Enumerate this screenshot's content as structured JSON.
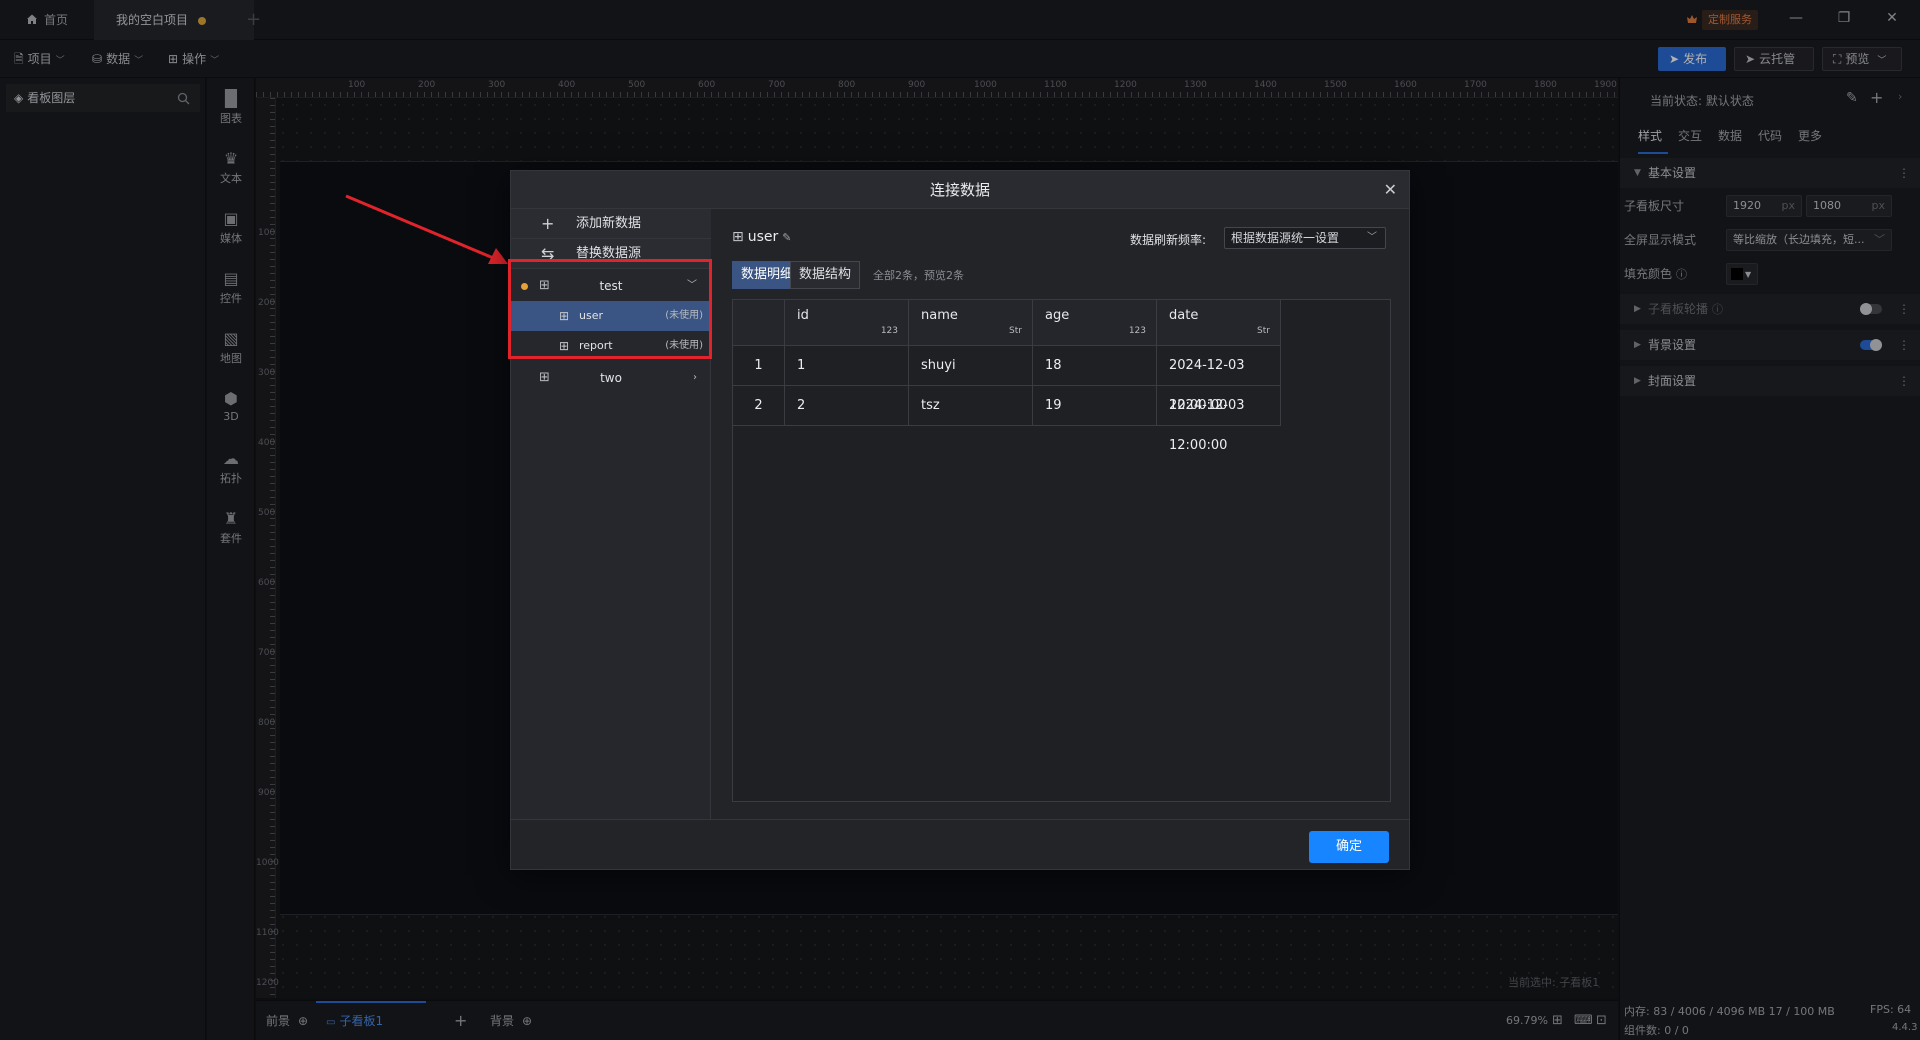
{
  "titlebar": {
    "home_tab": "首页",
    "project_tab": "我的空白项目",
    "custom_service": "定制服务",
    "minimize": "—",
    "restore": "❐",
    "close": "✕"
  },
  "menubar": {
    "project": "项目",
    "data": "数据",
    "operation": "操作",
    "publish": "发布",
    "cloud": "云托管",
    "preview": "预览"
  },
  "layers": {
    "title": "看板图层"
  },
  "components": [
    "图表",
    "文本",
    "媒体",
    "控件",
    "地图",
    "3D",
    "拓扑",
    "套件"
  ],
  "ruler": {
    "top": [
      "100",
      "200",
      "300",
      "400",
      "500",
      "600",
      "700",
      "800",
      "900",
      "1000",
      "1100",
      "1200",
      "1300",
      "1400",
      "1500",
      "1600",
      "1700",
      "1800",
      "1900"
    ],
    "left": [
      "100",
      "200",
      "300",
      "400",
      "500",
      "600",
      "700",
      "800",
      "900",
      "1000",
      "1100",
      "1200"
    ]
  },
  "canvas": {
    "status": "当前选中: 子看板1"
  },
  "right_panel": {
    "state": "当前状态: 默认状态",
    "tabs": [
      "样式",
      "交互",
      "数据",
      "代码",
      "更多"
    ],
    "basic_section": "基本设置",
    "size_label": "子看板尺寸",
    "width": "1920",
    "height": "1080",
    "unit": "px",
    "fullscreen_label": "全屏显示模式",
    "fullscreen_value": "等比缩放（长边填充，短...",
    "fill_label": "填充颜色",
    "carousel_section": "子看板轮播",
    "background_section": "背景设置",
    "cover_section": "封面设置"
  },
  "bottombar": {
    "front": "前景",
    "board": "子看板1",
    "back": "背景",
    "zoom": "69.79%"
  },
  "memory": {
    "memory": "内存: 83 / 4006 / 4096 MB  17 / 100 MB",
    "fps": "FPS: 64",
    "components": "组件数: 0 / 0",
    "version": "4.4.3"
  },
  "dialog": {
    "title": "连接数据",
    "add_data": "添加新数据",
    "replace_source": "替换数据源",
    "sources": [
      {
        "name": "test",
        "expanded": true
      },
      {
        "name": "two",
        "expanded": false
      }
    ],
    "tables": [
      {
        "name": "user",
        "tag": "(未使用)"
      },
      {
        "name": "report",
        "tag": "(未使用)"
      }
    ],
    "table_title": "user",
    "refresh_label": "数据刷新频率:",
    "refresh_value": "根据数据源统一设置",
    "tab_detail": "数据明细",
    "tab_structure": "数据结构",
    "count_text": "全部2条，预览2条",
    "columns": [
      {
        "name": "id",
        "type": "123"
      },
      {
        "name": "name",
        "type": "Str"
      },
      {
        "name": "age",
        "type": "123"
      },
      {
        "name": "date",
        "type": "Str"
      }
    ],
    "rows": [
      {
        "idx": "1",
        "id": "1",
        "name": "shuyi",
        "age": "18",
        "date": "2024-12-03 12:00:00"
      },
      {
        "idx": "2",
        "id": "2",
        "name": "tsz",
        "age": "19",
        "date": "2024-12-03 12:00:00"
      }
    ],
    "ok": "确定"
  },
  "colors": {
    "accent": "#2a6cd6",
    "highlight": "#e1242b",
    "ok_button": "#1685ff",
    "selected_row": "#3a5583"
  }
}
